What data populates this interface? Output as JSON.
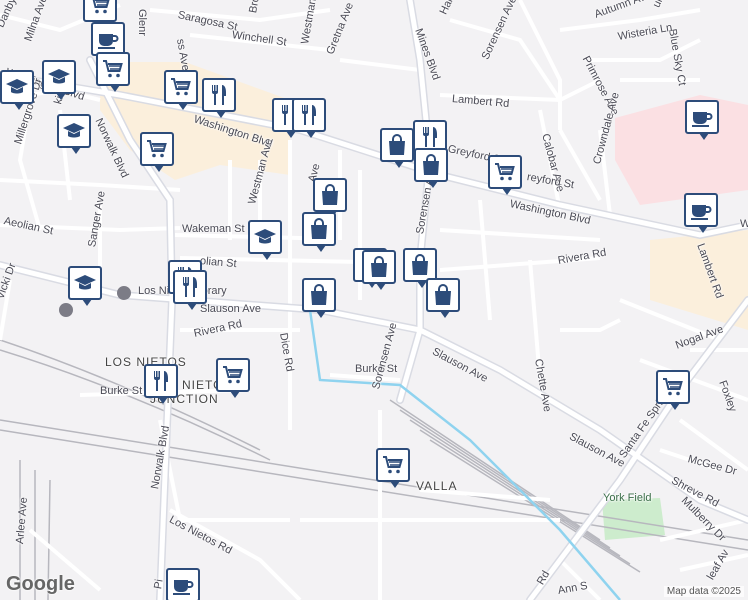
{
  "map": {
    "street_labels": [
      {
        "id": "glenr",
        "text": "Glenr"
      },
      {
        "id": "saragosa",
        "text": "Saragosa St"
      },
      {
        "id": "broo",
        "text": "Broo"
      },
      {
        "id": "winchell",
        "text": "Winchell St"
      },
      {
        "id": "gretna",
        "text": "Gretna Ave"
      },
      {
        "id": "westman_n",
        "text": "Westman Ave"
      },
      {
        "id": "mines",
        "text": "Mines Blvd"
      },
      {
        "id": "halray",
        "text": "Halray Ave"
      },
      {
        "id": "sorensen_n",
        "text": "Sorensen Ave"
      },
      {
        "id": "autumn",
        "text": "Autumn Ave"
      },
      {
        "id": "blue_sky",
        "text": "Blue Sky Ct"
      },
      {
        "id": "wisteria",
        "text": "Wisteria Ln"
      },
      {
        "id": "umleaf",
        "text": "umleaf Ave"
      },
      {
        "id": "primrose",
        "text": "Primrose Ave"
      },
      {
        "id": "lambert_rd",
        "text": "Lambert Rd"
      },
      {
        "id": "danby",
        "text": "Danby Ave"
      },
      {
        "id": "milna",
        "text": "Milna Ave"
      },
      {
        "id": "ss_ave",
        "text": "ss Ave"
      },
      {
        "id": "washington_w",
        "text": "Washington Blvd"
      },
      {
        "id": "washington_mid",
        "text": "Washington Blvd"
      },
      {
        "id": "washington_e",
        "text": "Washington Blvd"
      },
      {
        "id": "washington_far",
        "text": "W"
      },
      {
        "id": "millergrove",
        "text": "Millergrove Dr"
      },
      {
        "id": "norwalk_n",
        "text": "Norwalk Blvd"
      },
      {
        "id": "westman_s",
        "text": "Westman Ave"
      },
      {
        "id": "ki_dr",
        "text": "ki Dr"
      },
      {
        "id": "calobar",
        "text": "Calobar Ave"
      },
      {
        "id": "crowndale",
        "text": "Crowndale Ave"
      },
      {
        "id": "greyford",
        "text": "reyford St"
      },
      {
        "id": "greyford2",
        "text": "Greyford St"
      },
      {
        "id": "wakeman",
        "text": "Wakeman St"
      },
      {
        "id": "sanger",
        "text": "Sanger Ave"
      },
      {
        "id": "aeolian_w",
        "text": "Aeolian St"
      },
      {
        "id": "aeolian",
        "text": "olian St"
      },
      {
        "id": "ave_mid",
        "text": "Ave"
      },
      {
        "id": "sorensen_mid",
        "text": "Sorensen Ave"
      },
      {
        "id": "rivera_e",
        "text": "Rivera Rd"
      },
      {
        "id": "lambert_ave",
        "text": "Lambert Rd"
      },
      {
        "id": "vicki",
        "text": "Vicki Dr"
      },
      {
        "id": "library",
        "text": "Los Nietos Library"
      },
      {
        "id": "slauson_w",
        "text": "Slauson Ave"
      },
      {
        "id": "rivera_w",
        "text": "Rivera Rd"
      },
      {
        "id": "dice",
        "text": "Dice Rd"
      },
      {
        "id": "chette",
        "text": "Chette Ave"
      },
      {
        "id": "nogal",
        "text": "Nogal Ave"
      },
      {
        "id": "foxley",
        "text": "Foxley"
      },
      {
        "id": "slauson_mid",
        "text": "Slauson Ave"
      },
      {
        "id": "burke_mid",
        "text": "Burke St"
      },
      {
        "id": "sorensen_s",
        "text": "Sorensen Ave"
      },
      {
        "id": "burke_w",
        "text": "Burke St"
      },
      {
        "id": "slauson_e",
        "text": "Slauson Ave"
      },
      {
        "id": "santa_fe",
        "text": "Santa Fe Springs Rd"
      },
      {
        "id": "mcgee",
        "text": "McGee Dr"
      },
      {
        "id": "shreve",
        "text": "Shreve Rd"
      },
      {
        "id": "mulberry",
        "text": "Mulberry Dr"
      },
      {
        "id": "norwalk_s",
        "text": "Norwalk Blvd"
      },
      {
        "id": "arlee",
        "text": "Arlee Ave"
      },
      {
        "id": "los_nietos_rd",
        "text": "Los Nietos Rd"
      },
      {
        "id": "rd_s",
        "text": "Rd"
      },
      {
        "id": "ann",
        "text": "Ann S"
      },
      {
        "id": "leaf",
        "text": "leaf Av"
      },
      {
        "id": "pi",
        "text": "Pi"
      }
    ],
    "area_labels": [
      {
        "id": "los_nietos",
        "text": "LOS NIETOS"
      },
      {
        "id": "nietos_junction",
        "text": "NIETOS"
      },
      {
        "id": "junction",
        "text": "JUNCTION"
      },
      {
        "id": "valla",
        "text": "VALLA"
      },
      {
        "id": "york_field",
        "text": "York Field"
      }
    ],
    "pins": [
      {
        "type": "shopping-cart-icon"
      },
      {
        "type": "coffee-icon"
      },
      {
        "type": "graduation-cap-icon"
      },
      {
        "type": "shopping-cart-icon"
      },
      {
        "type": "graduation-cap-icon"
      },
      {
        "type": "shopping-cart-icon"
      },
      {
        "type": "restaurant-icon"
      },
      {
        "type": "restaurant-icon"
      },
      {
        "type": "restaurant-icon"
      },
      {
        "type": "graduation-cap-icon"
      },
      {
        "type": "shopping-cart-icon"
      },
      {
        "type": "shopping-bag-icon"
      },
      {
        "type": "restaurant-icon"
      },
      {
        "type": "shopping-bag-icon"
      },
      {
        "type": "shopping-cart-icon"
      },
      {
        "type": "shopping-bag-icon"
      },
      {
        "type": "coffee-icon"
      },
      {
        "type": "coffee-icon"
      },
      {
        "type": "shopping-bag-icon"
      },
      {
        "type": "graduation-cap-icon"
      },
      {
        "type": "shopping-bag-icon"
      },
      {
        "type": "shopping-bag-icon"
      },
      {
        "type": "shopping-bag-icon"
      },
      {
        "type": "graduation-cap-icon"
      },
      {
        "type": "restaurant-icon"
      },
      {
        "type": "shopping-bag-icon"
      },
      {
        "type": "restaurant-icon"
      },
      {
        "type": "shopping-bag-icon"
      },
      {
        "type": "shopping-cart-icon"
      },
      {
        "type": "restaurant-icon"
      },
      {
        "type": "shopping-cart-icon"
      },
      {
        "type": "shopping-cart-icon"
      },
      {
        "type": "coffee-icon"
      }
    ],
    "google_logo": "Google",
    "attribution": "Map data ©2025",
    "colors": {
      "background": "#f3f2f4",
      "road": "#ffffff",
      "road_outline": "#c8c8d0",
      "major_road": "#d9dbe3",
      "commercial": "#fbefdc",
      "hospital": "#fbe0e3",
      "park": "#cdeccd",
      "rail": "#b7b7be",
      "water": "#8fd3ef",
      "pin_border": "#2d4c7a"
    }
  }
}
